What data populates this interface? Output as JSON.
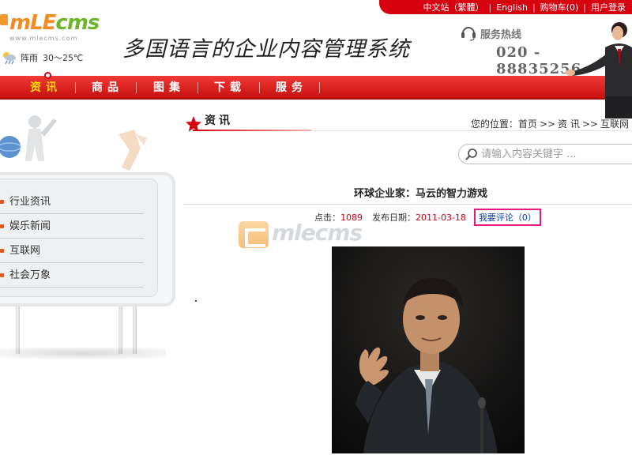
{
  "topbar": {
    "links": [
      "中文站（繁體）",
      "English",
      "购物车(0)",
      "用户登录"
    ],
    "separator": "|"
  },
  "logo": {
    "text_part1": "mLE",
    "text_part2": "cms",
    "subtext": "www.mlecms.com"
  },
  "weather": {
    "condition": "阵雨",
    "temperature": "30～25℃"
  },
  "slogan": "多国语言的企业内容管理系统",
  "hotline": {
    "label": "服务热线",
    "number": "020 - 88835256"
  },
  "nav": {
    "items": [
      {
        "label": "资讯",
        "active": true
      },
      {
        "label": "商品",
        "active": false
      },
      {
        "label": "图集",
        "active": false
      },
      {
        "label": "下载",
        "active": false
      },
      {
        "label": "服务",
        "active": false
      }
    ]
  },
  "sidebar": {
    "categories": [
      "行业资讯",
      "娱乐新闻",
      "互联网",
      "社会万象"
    ]
  },
  "section": {
    "title": "资讯",
    "breadcrumb": {
      "prefix": "您的位置：",
      "items": [
        "首页",
        "资 讯",
        "互联网"
      ],
      "separator": ">>"
    }
  },
  "search": {
    "placeholder": "请输入内容关键字 ..."
  },
  "article": {
    "title": "环球企业家：马云的智力游戏",
    "hits_label": "点击：",
    "hits": "1089",
    "date_label": "发布日期：",
    "date": "2011-03-18",
    "comment_link": "我要评论（0）"
  },
  "watermark": {
    "text": "mlecms"
  },
  "colors": {
    "brand_red": "#d6000f",
    "nav_active": "#ffdd00",
    "highlight_border": "#e8157c",
    "link_blue": "#0b3ea8"
  }
}
